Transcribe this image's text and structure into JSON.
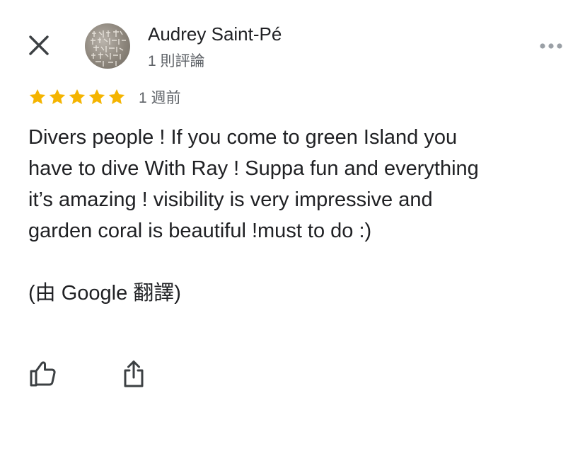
{
  "header": {
    "author_name": "Audrey Saint-Pé",
    "review_count": "1 則評論",
    "icons": {
      "close": "close-icon",
      "avatar": "avatar",
      "more": "more-horizontal-icon"
    }
  },
  "rating": {
    "stars": 5,
    "max_stars": 5,
    "time_ago": "1 週前",
    "star_color": "#F4B400"
  },
  "review": {
    "lines": [
      "Divers people ! If you come to green Island you",
      "have to dive With Ray ! Suppa fun and everything",
      "it’s amazing ! visibility is very impressive and",
      "garden coral is beautiful !must to do :)"
    ],
    "translated_by": "(由 Google 翻譯)"
  },
  "actions": {
    "like_icon": "thumb-up-icon",
    "share_icon": "share-icon"
  },
  "colors": {
    "primary_text": "#202124",
    "secondary_text": "#5f6368",
    "icon": "#3c4043",
    "more_icon": "#9aa0a6"
  }
}
